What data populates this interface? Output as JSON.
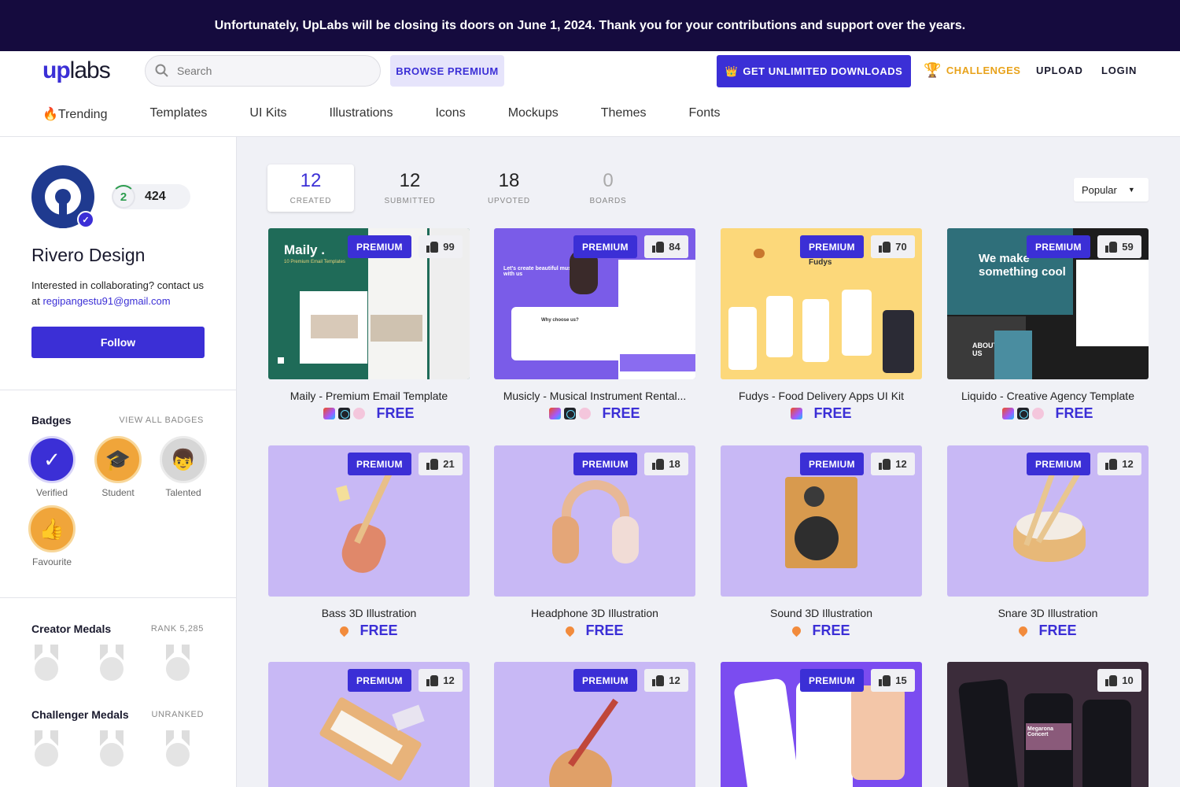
{
  "banner": {
    "text": "Unfortunately, UpLabs will be closing its doors on June 1, 2024. Thank you for your contributions and support over the years."
  },
  "header": {
    "logo_up": "up",
    "logo_labs": "labs",
    "search_placeholder": "Search",
    "browse_premium": "BROWSE PREMIUM",
    "unlimited": "GET UNLIMITED DOWNLOADS",
    "challenges": "CHALLENGES",
    "upload": "UPLOAD",
    "login": "LOGIN"
  },
  "categories": [
    "🔥Trending",
    "Templates",
    "UI Kits",
    "Illustrations",
    "Icons",
    "Mockups",
    "Themes",
    "Fonts"
  ],
  "profile": {
    "level": "2",
    "points": "424",
    "name": "Rivero Design",
    "bio": "Interested in collaborating? contact us at",
    "email": "regipangestu91@gmail.com",
    "follow": "Follow"
  },
  "badges": {
    "title": "Badges",
    "view_all": "VIEW ALL BADGES",
    "items": [
      {
        "label": "Verified",
        "color": "#3b2fd6",
        "icon": "check-icon"
      },
      {
        "label": "Student",
        "color": "#f0a53a",
        "icon": "graduation-cap-icon"
      },
      {
        "label": "Talented",
        "color": "#d6d6d6",
        "icon": "face-icon"
      },
      {
        "label": "Favourite",
        "color": "#f0a53a",
        "icon": "thumbs-up-icon"
      }
    ]
  },
  "creator_medals": {
    "title": "Creator Medals",
    "rank": "RANK 5,285"
  },
  "challenger_medals": {
    "title": "Challenger Medals",
    "rank": "UNRANKED"
  },
  "stats": [
    {
      "value": "12",
      "label": "CREATED"
    },
    {
      "value": "12",
      "label": "SUBMITTED"
    },
    {
      "value": "18",
      "label": "UPVOTED"
    },
    {
      "value": "0",
      "label": "BOARDS"
    }
  ],
  "sort": {
    "selected": "Popular"
  },
  "cards": [
    {
      "title": "Maily - Premium Email Template",
      "likes": "99",
      "premium": "PREMIUM",
      "price": "FREE",
      "tools": [
        "figma",
        "react",
        "sass"
      ]
    },
    {
      "title": "Musicly - Musical Instrument Rental...",
      "likes": "84",
      "premium": "PREMIUM",
      "price": "FREE",
      "tools": [
        "figma",
        "react",
        "sass"
      ]
    },
    {
      "title": "Fudys - Food Delivery Apps UI Kit",
      "likes": "70",
      "premium": "PREMIUM",
      "price": "FREE",
      "tools": [
        "figma"
      ]
    },
    {
      "title": "Liquido - Creative Agency Template",
      "likes": "59",
      "premium": "PREMIUM",
      "price": "FREE",
      "tools": [
        "figma",
        "react",
        "sass"
      ]
    },
    {
      "title": "Bass 3D Illustration",
      "likes": "21",
      "premium": "PREMIUM",
      "price": "FREE",
      "tools": [
        "pin"
      ]
    },
    {
      "title": "Headphone 3D Illustration",
      "likes": "18",
      "premium": "PREMIUM",
      "price": "FREE",
      "tools": [
        "pin"
      ]
    },
    {
      "title": "Sound 3D Illustration",
      "likes": "12",
      "premium": "PREMIUM",
      "price": "FREE",
      "tools": [
        "pin"
      ]
    },
    {
      "title": "Snare 3D Illustration",
      "likes": "12",
      "premium": "PREMIUM",
      "price": "FREE",
      "tools": [
        "pin"
      ]
    },
    {
      "title": "",
      "likes": "12",
      "premium": "PREMIUM",
      "price": "",
      "tools": []
    },
    {
      "title": "",
      "likes": "12",
      "premium": "PREMIUM",
      "price": "",
      "tools": []
    },
    {
      "title": "",
      "likes": "15",
      "premium": "PREMIUM",
      "price": "",
      "tools": []
    },
    {
      "title": "",
      "likes": "10",
      "premium": "",
      "price": "",
      "tools": []
    }
  ],
  "thumb_texts": {
    "maily": "Maily .",
    "maily_sub": "10 Premium Email Templates",
    "musicly": "Let's create beautiful music with us",
    "musicly_why": "Why choose us?",
    "fudys": "Fudys",
    "liquido": "We make something cool",
    "liquido_about": "ABOUT US",
    "megarona": "Megarona Concert"
  }
}
